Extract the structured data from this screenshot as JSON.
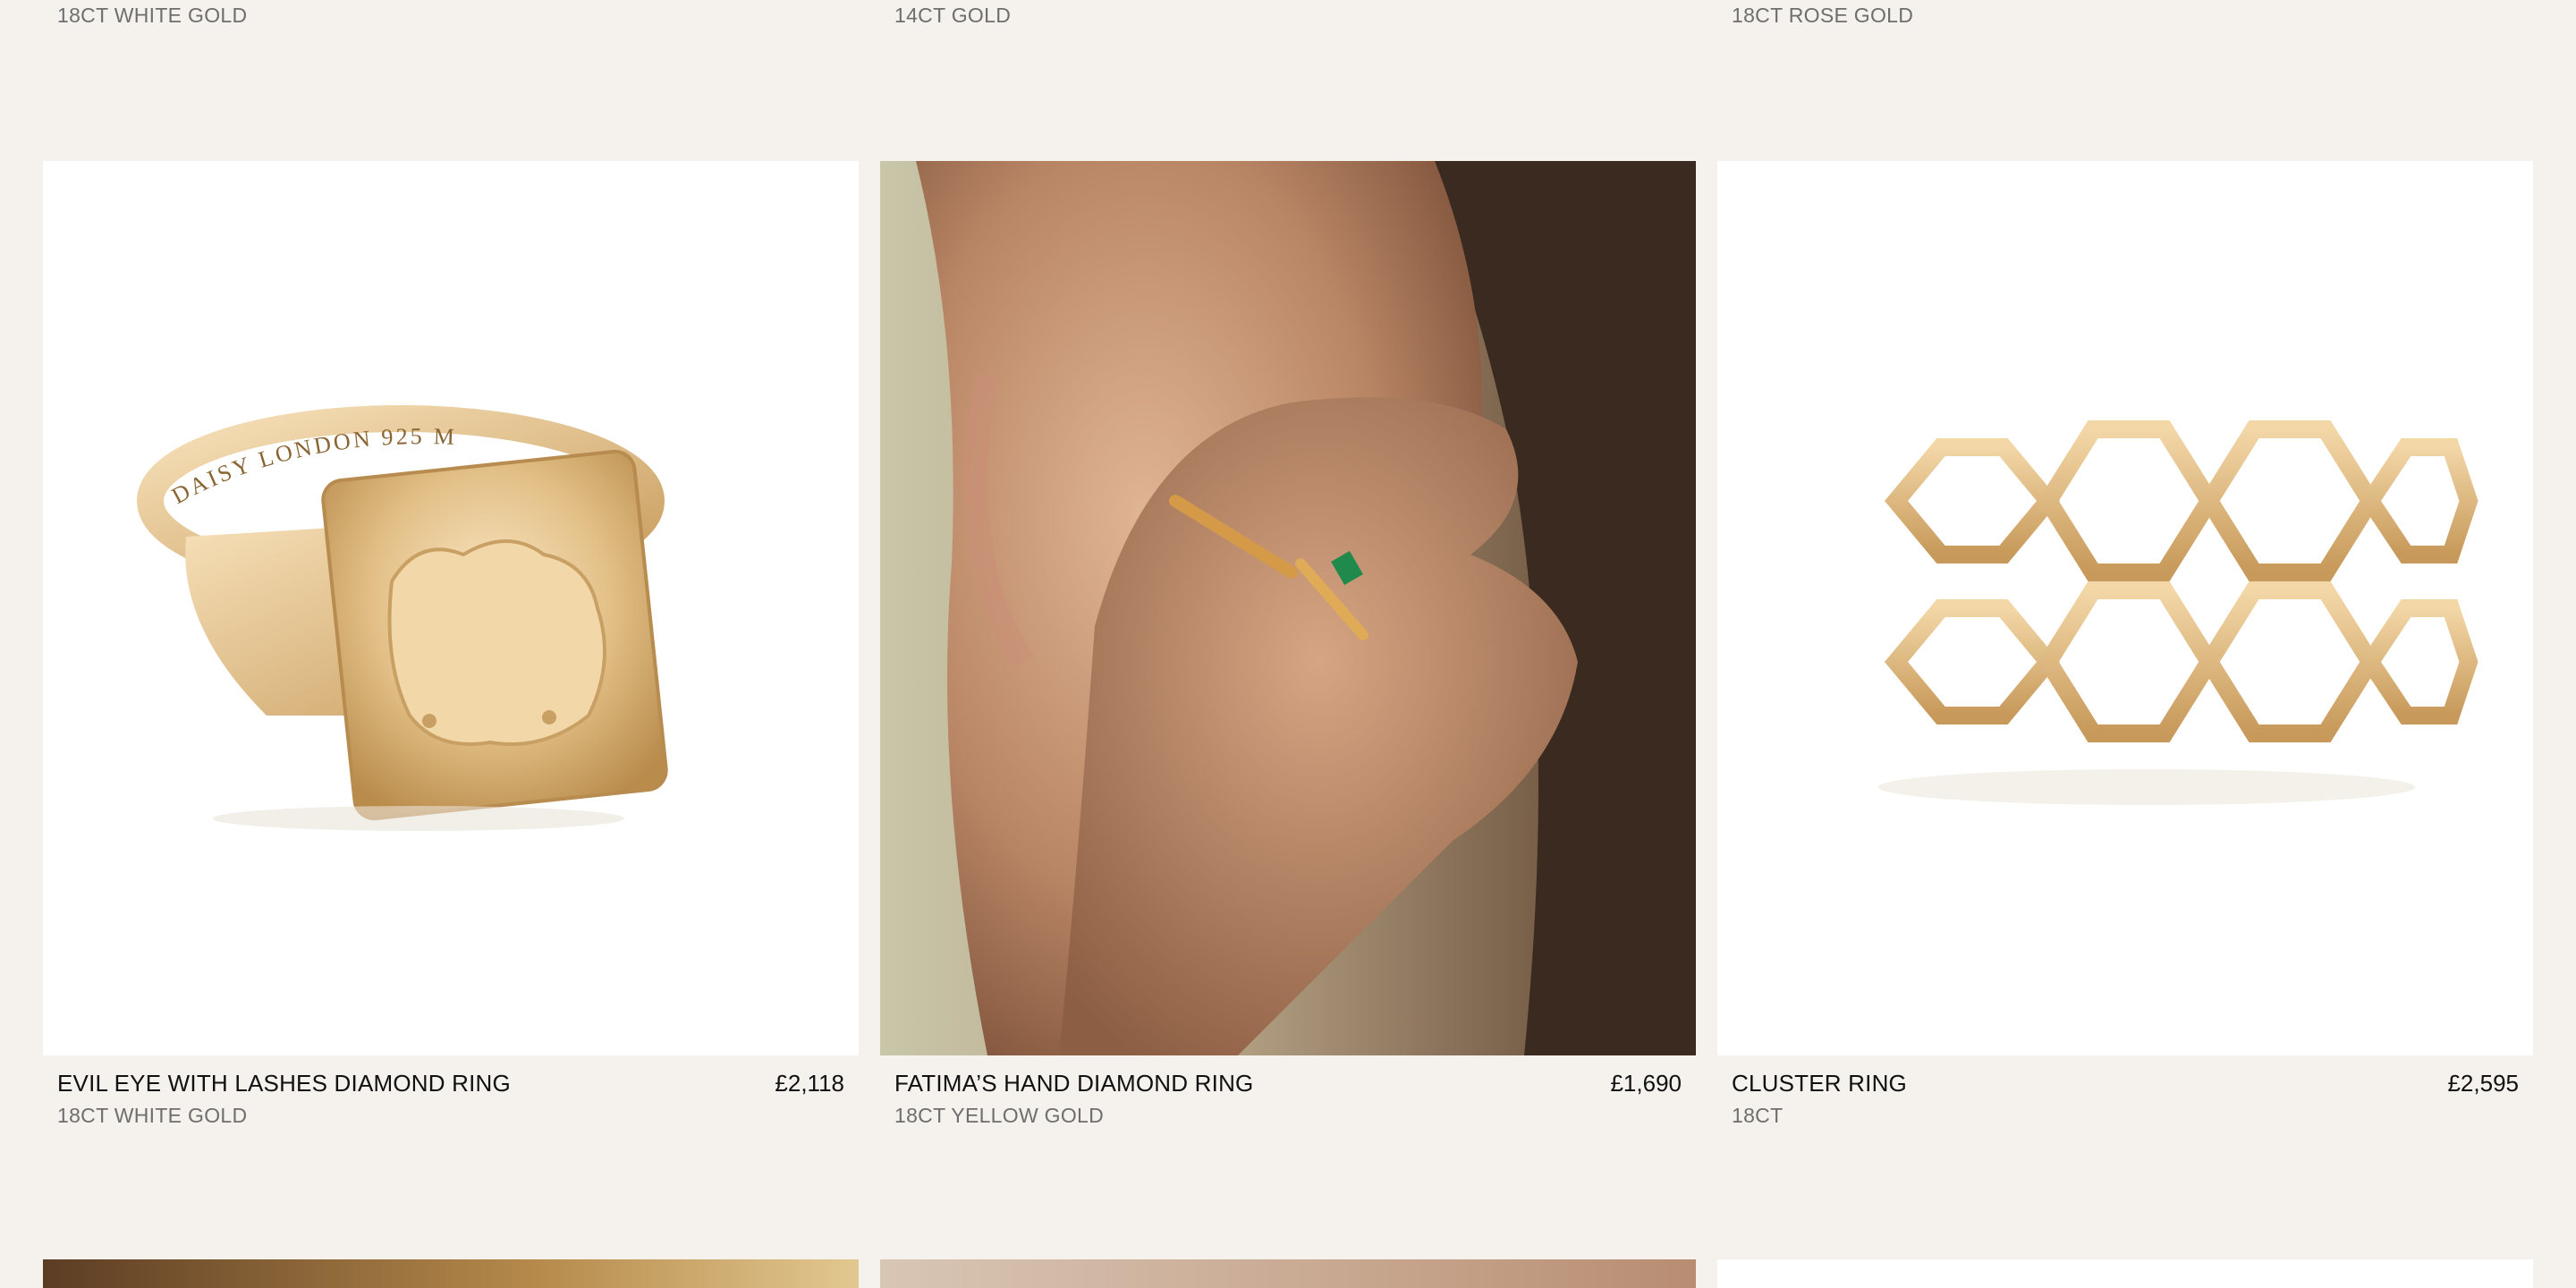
{
  "previous_row": [
    {
      "material": "18CT WHITE GOLD"
    },
    {
      "material": "14CT GOLD"
    },
    {
      "material": "18CT ROSE GOLD"
    }
  ],
  "products": [
    {
      "name": "EVIL EYE WITH LASHES DIAMOND RING",
      "price": "£2,118",
      "material": "18CT WHITE GOLD",
      "image": "signet-ring-photo",
      "engraving": "DAISY  LONDON  925 M"
    },
    {
      "name": "FATIMA’S HAND DIAMOND RING",
      "price": "£1,690",
      "material": "18CT YELLOW GOLD",
      "image": "model-wearing-rings-photo"
    },
    {
      "name": "CLUSTER RING",
      "price": "£2,595",
      "material": "18CT",
      "image": "hexagon-band-ring-photo"
    }
  ],
  "colors": {
    "background": "#f5f1ec",
    "text": "#111111",
    "muted": "#6e6e6e",
    "gold": "#d8b378"
  }
}
